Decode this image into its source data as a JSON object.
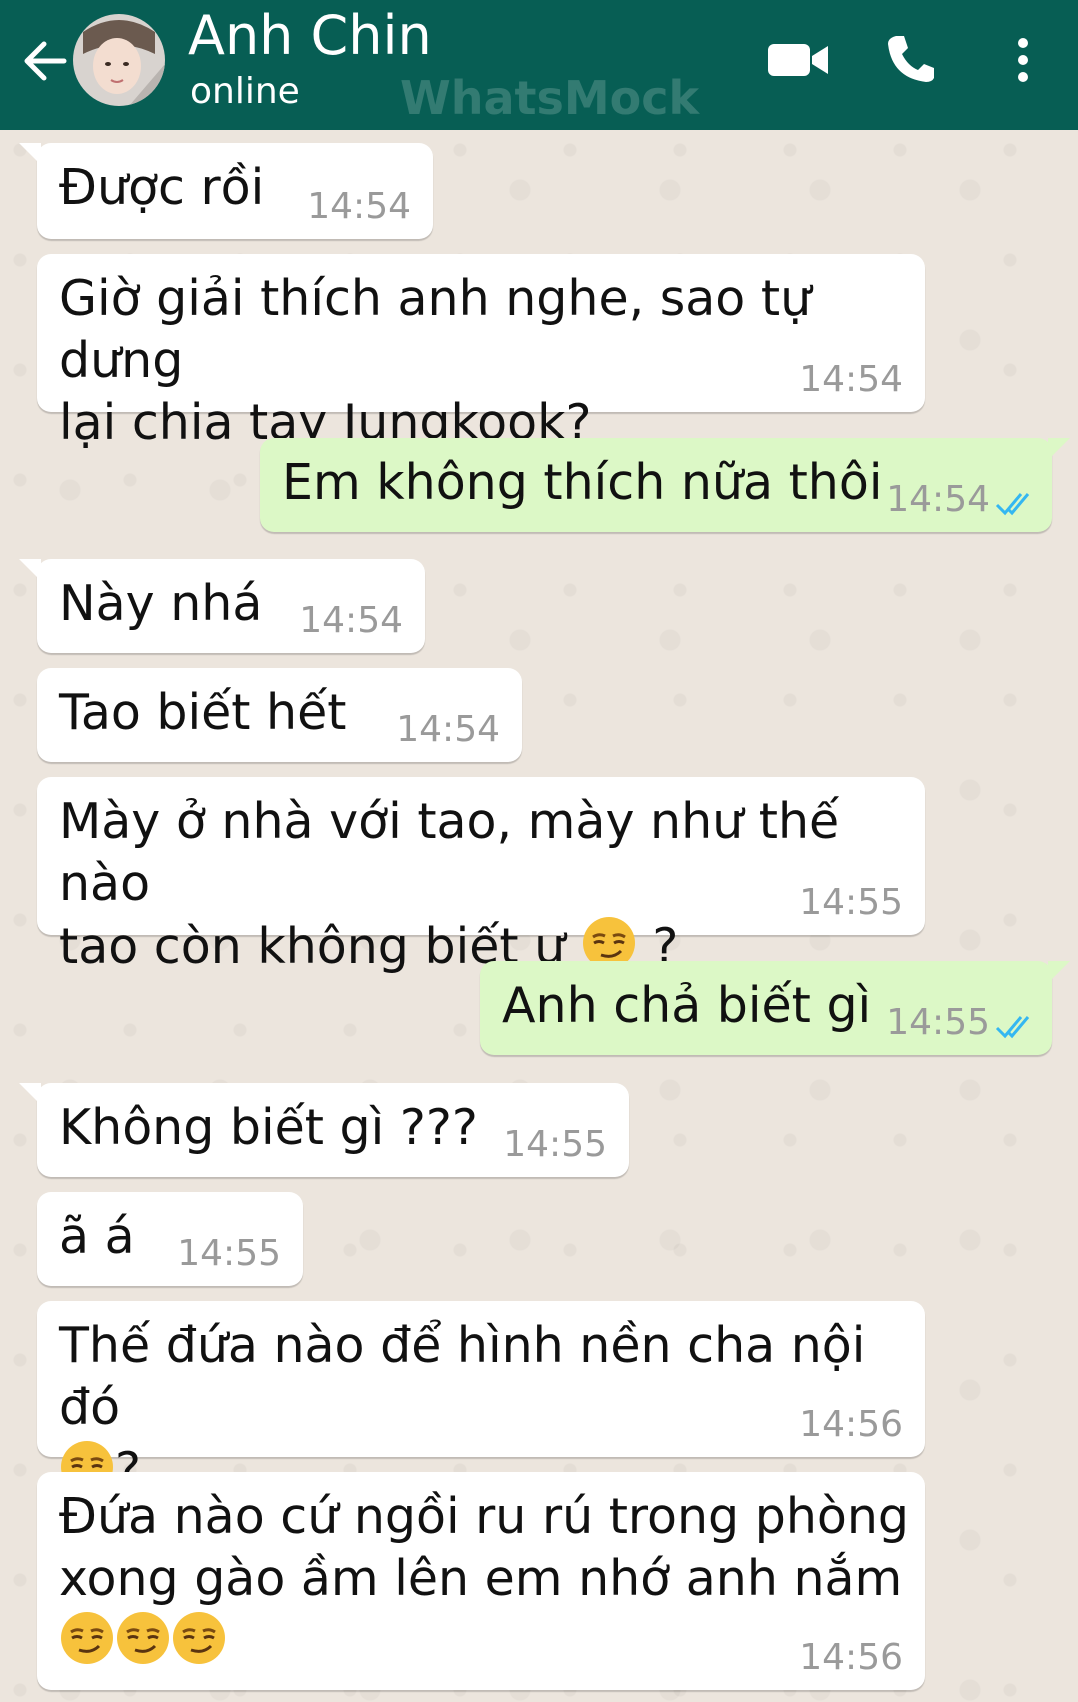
{
  "header": {
    "contact_name": "Anh Chin",
    "status": "online",
    "watermark": "WhatsMock",
    "back_icon": "back-arrow-icon",
    "video_icon": "video-call-icon",
    "call_icon": "phone-icon",
    "menu_icon": "more-vert-icon",
    "bg_color": "#075e54"
  },
  "colors": {
    "incoming_bubble": "#ffffff",
    "outgoing_bubble": "#dcf8c6",
    "chat_background": "#ece5dd",
    "read_ticks": "#34b7f1"
  },
  "messages": [
    {
      "direction": "in",
      "text": "Được rồi",
      "time": "14:54"
    },
    {
      "direction": "in",
      "text_lines": [
        "Giờ giải thích anh nghe, sao tự dưng",
        "lại chia tay Jungkook?"
      ],
      "time": "14:54"
    },
    {
      "direction": "out",
      "text": "Em không thích nữa thôi",
      "time": "14:54",
      "status": "read"
    },
    {
      "direction": "in",
      "text": "Này nhá",
      "time": "14:54"
    },
    {
      "direction": "in",
      "text": "Tao biết hết",
      "time": "14:54"
    },
    {
      "direction": "in",
      "text_lines": [
        "Mày ở nhà với tao, mày như thế nào",
        "tao còn không biết ư",
        " ?"
      ],
      "emoji": "smirking-face",
      "time": "14:55"
    },
    {
      "direction": "out",
      "text": "Anh chả biết gì",
      "time": "14:55",
      "status": "read"
    },
    {
      "direction": "in",
      "text": "Không biết gì ???",
      "time": "14:55"
    },
    {
      "direction": "in",
      "text": "ã á",
      "time": "14:55"
    },
    {
      "direction": "in",
      "text_lines": [
        "Thế đứa nào để hình nền cha nội đó",
        "?"
      ],
      "emoji": "smirking-face",
      "time": "14:56"
    },
    {
      "direction": "in",
      "text_lines": [
        "Đứa nào cứ ngồi ru rú trong phòng",
        "xong gào ầm lên em nhớ anh nắm"
      ],
      "emoji_count": 3,
      "emoji": "smirking-face",
      "time": "14:56"
    }
  ]
}
